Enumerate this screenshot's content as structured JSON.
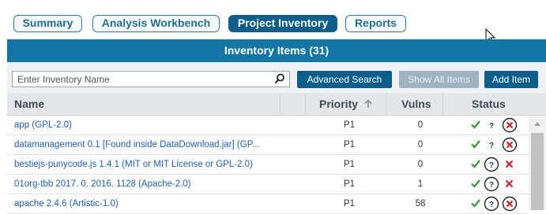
{
  "tabs": [
    {
      "label": "Summary"
    },
    {
      "label": "Analysis Workbench"
    },
    {
      "label": "Project Inventory"
    },
    {
      "label": "Reports"
    }
  ],
  "panel_title": "Inventory Items (31)",
  "search": {
    "placeholder": "Enter Inventory Name"
  },
  "toolbar": {
    "advanced_search": "Advanced Search",
    "show_all_items": "Show All Items",
    "add_item": "Add Item"
  },
  "columns": {
    "name": "Name",
    "priority": "Priority",
    "vulns": "Vulns",
    "status": "Status"
  },
  "rows": [
    {
      "name": "app (GPL-2.0)",
      "priority": "P1",
      "vulns": "0",
      "status": "approved-question-rejected"
    },
    {
      "name": "datamanagement 0.1 [Found inside DataDownload.jar] (GP...",
      "priority": "P1",
      "vulns": "0",
      "status": "approved-question-rejected"
    },
    {
      "name": "bestiejs-punycode.js 1.4.1 (MIT or MIT License or GPL-2.0)",
      "priority": "P1",
      "vulns": "0",
      "status": "approved-question-rejected"
    },
    {
      "name": "01org-tbb 2017. 0. 2016. 1128 (Apache-2.0)",
      "priority": "P1",
      "vulns": "1",
      "status": "approved-question-rejected"
    },
    {
      "name": "apache 2.4.6 (Artistic-1.0)",
      "priority": "P1",
      "vulns": "58",
      "status": "approved-question-rejected"
    }
  ],
  "colors": {
    "accent": "#1476a4",
    "button": "#0d5e8a",
    "link": "#1a5fc9",
    "approve": "#2e9b2e",
    "reject": "#d3202a"
  }
}
